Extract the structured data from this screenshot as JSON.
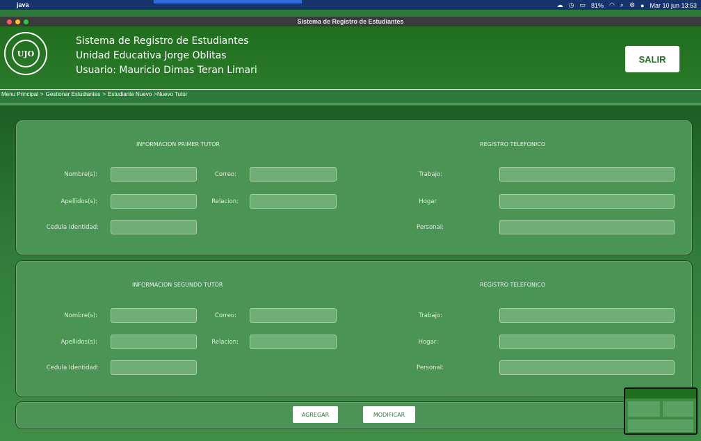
{
  "menubar": {
    "app_name": "java",
    "battery": "81%",
    "datetime": "Mar 10 jun 13:53"
  },
  "window": {
    "title": "Sistema de Registro de Estudiantes"
  },
  "header": {
    "line1": "Sistema de Registro de Estudiantes",
    "line2": "Unidad Educativa Jorge Oblitas",
    "line3": "Usuario: Mauricio Dimas Teran Limari",
    "logo_text": "UJO",
    "salir_label": "SALIR"
  },
  "breadcrumb": [
    "Menu Principal",
    ">",
    "Gestionar Estudiantes",
    ">",
    "Estudiante Nuevo",
    ">Nuevo Tutor"
  ],
  "tutor1": {
    "title": "INFORMACION PRIMER TUTOR",
    "phone_title": "REGISTRO TELEFONICO",
    "nombre": "Nombre(s):",
    "apellidos": "Apellidos(s):",
    "cedula": "Cedula Identidad:",
    "correo": "Correo:",
    "relacion": "Relacion:",
    "trabajo": "Trabajo:",
    "hogar": "Hogar",
    "personal": "Personal:"
  },
  "tutor2": {
    "title": "INFORMACION SEGUNDO TUTOR",
    "phone_title": "REGISTRO TELEFONICO",
    "nombre": "Nombre(s):",
    "apellidos": "Apellidos(s):",
    "cedula": "Cedula Identidad:",
    "correo": "Correo:",
    "relacion": "Relacion:",
    "trabajo": "Trabajo:",
    "hogar": "Hogar:",
    "personal": "Personal:"
  },
  "actions": {
    "agregar": "AGREGAR",
    "modificar": "MODIFICAR"
  }
}
